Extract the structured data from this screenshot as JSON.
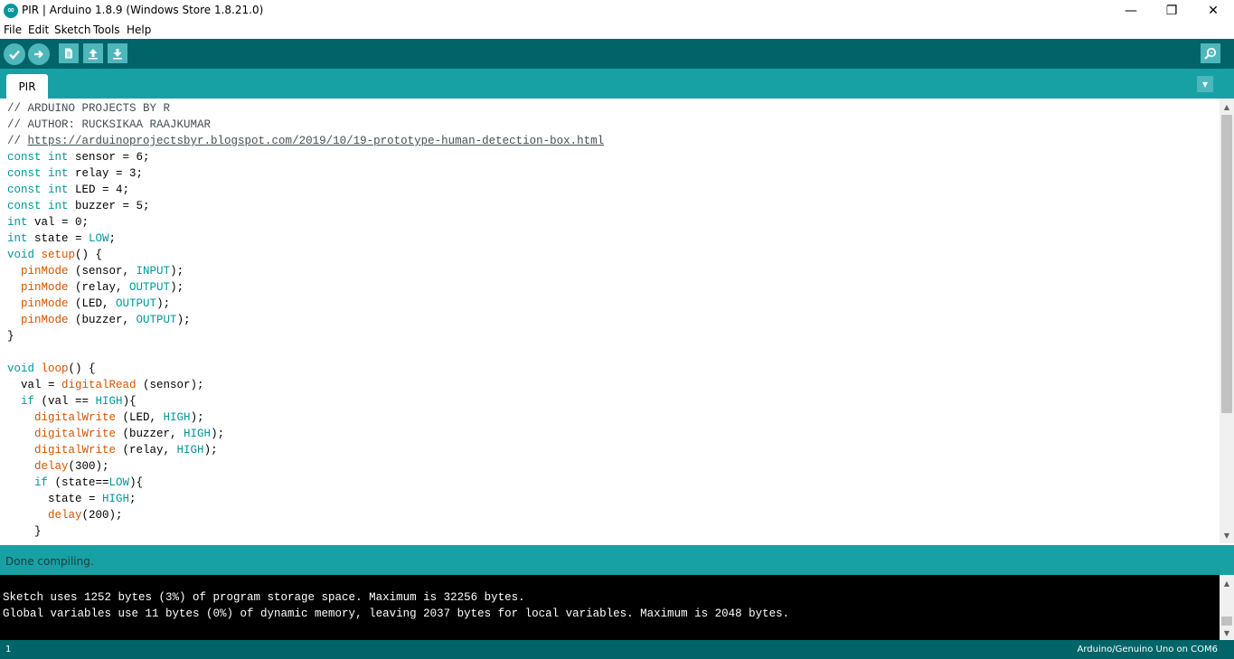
{
  "window": {
    "title": "PIR | Arduino 1.8.9 (Windows Store 1.8.21.0)",
    "icon_glyph": "∞",
    "minimize_glyph": "—",
    "maximize_glyph": "❐",
    "close_glyph": "✕"
  },
  "menu": [
    "File",
    "Edit",
    "Sketch",
    "Tools",
    "Help"
  ],
  "toolbar": {
    "buttons": [
      "verify-icon",
      "upload-icon",
      "new-icon",
      "open-icon",
      "save-icon"
    ],
    "right": "serial-monitor-icon",
    "colors": {
      "bar": "#006468",
      "button": "#4db7bb"
    }
  },
  "tabs": [
    {
      "label": "PIR",
      "active": true
    }
  ],
  "tab_menu_glyph": "▾",
  "code": [
    [
      [
        "cmt",
        "// ARDUINO PROJECTS BY R"
      ]
    ],
    [
      [
        "cmt",
        "// AUTHOR: RUCKSIKAA RAAJKUMAR"
      ]
    ],
    [
      [
        "cmt",
        "// "
      ],
      [
        "link",
        "https://arduinoprojectsbyr.blogspot.com/2019/10/19-prototype-human-detection-box.html"
      ]
    ],
    [
      [
        "kw",
        "const"
      ],
      [
        "",
        " "
      ],
      [
        "kw",
        "int"
      ],
      [
        "",
        " sensor = 6;"
      ]
    ],
    [
      [
        "kw",
        "const"
      ],
      [
        "",
        " "
      ],
      [
        "kw",
        "int"
      ],
      [
        "",
        " relay = 3;"
      ]
    ],
    [
      [
        "kw",
        "const"
      ],
      [
        "",
        " "
      ],
      [
        "kw",
        "int"
      ],
      [
        "",
        " LED = 4;"
      ]
    ],
    [
      [
        "kw",
        "const"
      ],
      [
        "",
        " "
      ],
      [
        "kw",
        "int"
      ],
      [
        "",
        " buzzer = 5;"
      ]
    ],
    [
      [
        "kw",
        "int"
      ],
      [
        "",
        " val = 0;"
      ]
    ],
    [
      [
        "kw",
        "int"
      ],
      [
        "",
        " state = "
      ],
      [
        "const",
        "LOW"
      ],
      [
        "",
        ";"
      ]
    ],
    [
      [
        "kw",
        "void"
      ],
      [
        "",
        " "
      ],
      [
        "fn",
        "setup"
      ],
      [
        "",
        "() {"
      ]
    ],
    [
      [
        "",
        "  "
      ],
      [
        "fn",
        "pinMode"
      ],
      [
        "",
        " (sensor, "
      ],
      [
        "const",
        "INPUT"
      ],
      [
        "",
        ");"
      ]
    ],
    [
      [
        "",
        "  "
      ],
      [
        "fn",
        "pinMode"
      ],
      [
        "",
        " (relay, "
      ],
      [
        "const",
        "OUTPUT"
      ],
      [
        "",
        ");"
      ]
    ],
    [
      [
        "",
        "  "
      ],
      [
        "fn",
        "pinMode"
      ],
      [
        "",
        " (LED, "
      ],
      [
        "const",
        "OUTPUT"
      ],
      [
        "",
        ");"
      ]
    ],
    [
      [
        "",
        "  "
      ],
      [
        "fn",
        "pinMode"
      ],
      [
        "",
        " (buzzer, "
      ],
      [
        "const",
        "OUTPUT"
      ],
      [
        "",
        ");"
      ]
    ],
    [
      [
        "",
        "}"
      ]
    ],
    [],
    [
      [
        "kw",
        "void"
      ],
      [
        "",
        " "
      ],
      [
        "fn",
        "loop"
      ],
      [
        "",
        "() {"
      ]
    ],
    [
      [
        "",
        "  val = "
      ],
      [
        "fn",
        "digitalRead"
      ],
      [
        "",
        " (sensor);"
      ]
    ],
    [
      [
        "",
        "  "
      ],
      [
        "kw",
        "if"
      ],
      [
        "",
        " (val == "
      ],
      [
        "const",
        "HIGH"
      ],
      [
        "",
        "){"
      ]
    ],
    [
      [
        "",
        "    "
      ],
      [
        "fn",
        "digitalWrite"
      ],
      [
        "",
        " (LED, "
      ],
      [
        "const",
        "HIGH"
      ],
      [
        "",
        ");"
      ]
    ],
    [
      [
        "",
        "    "
      ],
      [
        "fn",
        "digitalWrite"
      ],
      [
        "",
        " (buzzer, "
      ],
      [
        "const",
        "HIGH"
      ],
      [
        "",
        ");"
      ]
    ],
    [
      [
        "",
        "    "
      ],
      [
        "fn",
        "digitalWrite"
      ],
      [
        "",
        " (relay, "
      ],
      [
        "const",
        "HIGH"
      ],
      [
        "",
        ");"
      ]
    ],
    [
      [
        "",
        "    "
      ],
      [
        "fn",
        "delay"
      ],
      [
        "",
        "(300);"
      ]
    ],
    [
      [
        "",
        "    "
      ],
      [
        "kw",
        "if"
      ],
      [
        "",
        " (state=="
      ],
      [
        "const",
        "LOW"
      ],
      [
        "",
        "){"
      ]
    ],
    [
      [
        "",
        "      state = "
      ],
      [
        "const",
        "HIGH"
      ],
      [
        "",
        ";"
      ]
    ],
    [
      [
        "",
        "      "
      ],
      [
        "fn",
        "delay"
      ],
      [
        "",
        "(200);"
      ]
    ],
    [
      [
        "",
        "    }"
      ]
    ]
  ],
  "status": {
    "message": "Done compiling."
  },
  "console": [
    "Sketch uses 1252 bytes (3%) of program storage space. Maximum is 32256 bytes.",
    "Global variables use 11 bytes (0%) of dynamic memory, leaving 2037 bytes for local variables. Maximum is 2048 bytes."
  ],
  "footer": {
    "line": "1",
    "board": "Arduino/Genuino Uno on COM6"
  },
  "scroll_arrows": {
    "up": "▲",
    "down": "▼"
  }
}
